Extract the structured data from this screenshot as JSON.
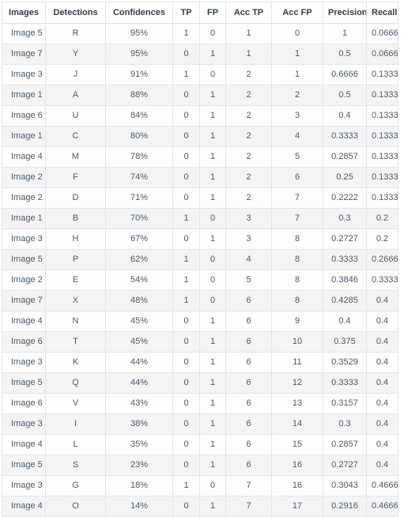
{
  "table": {
    "columns": [
      "Images",
      "Detections",
      "Confidences",
      "TP",
      "FP",
      "Acc TP",
      "Acc FP",
      "Precision",
      "Recall"
    ],
    "rows": [
      [
        "Image 5",
        "R",
        "95%",
        "1",
        "0",
        "1",
        "0",
        "1",
        "0.0666"
      ],
      [
        "Image 7",
        "Y",
        "95%",
        "0",
        "1",
        "1",
        "1",
        "0.5",
        "0.0666"
      ],
      [
        "Image 3",
        "J",
        "91%",
        "1",
        "0",
        "2",
        "1",
        "0.6666",
        "0.1333"
      ],
      [
        "Image 1",
        "A",
        "88%",
        "0",
        "1",
        "2",
        "2",
        "0.5",
        "0.1333"
      ],
      [
        "Image 6",
        "U",
        "84%",
        "0",
        "1",
        "2",
        "3",
        "0.4",
        "0.1333"
      ],
      [
        "Image 1",
        "C",
        "80%",
        "0",
        "1",
        "2",
        "4",
        "0.3333",
        "0.1333"
      ],
      [
        "Image 4",
        "M",
        "78%",
        "0",
        "1",
        "2",
        "5",
        "0.2857",
        "0.1333"
      ],
      [
        "Image 2",
        "F",
        "74%",
        "0",
        "1",
        "2",
        "6",
        "0.25",
        "0.1333"
      ],
      [
        "Image 2",
        "D",
        "71%",
        "0",
        "1",
        "2",
        "7",
        "0.2222",
        "0.1333"
      ],
      [
        "Image 1",
        "B",
        "70%",
        "1",
        "0",
        "3",
        "7",
        "0.3",
        "0.2"
      ],
      [
        "Image 3",
        "H",
        "67%",
        "0",
        "1",
        "3",
        "8",
        "0.2727",
        "0.2"
      ],
      [
        "Image 5",
        "P",
        "62%",
        "1",
        "0",
        "4",
        "8",
        "0.3333",
        "0.2666"
      ],
      [
        "Image 2",
        "E",
        "54%",
        "1",
        "0",
        "5",
        "8",
        "0.3846",
        "0.3333"
      ],
      [
        "Image 7",
        "X",
        "48%",
        "1",
        "0",
        "6",
        "8",
        "0.4285",
        "0.4"
      ],
      [
        "Image 4",
        "N",
        "45%",
        "0",
        "1",
        "6",
        "9",
        "0.4",
        "0.4"
      ],
      [
        "Image 6",
        "T",
        "45%",
        "0",
        "1",
        "6",
        "10",
        "0.375",
        "0.4"
      ],
      [
        "Image 3",
        "K",
        "44%",
        "0",
        "1",
        "6",
        "11",
        "0.3529",
        "0.4"
      ],
      [
        "Image 5",
        "Q",
        "44%",
        "0",
        "1",
        "6",
        "12",
        "0.3333",
        "0.4"
      ],
      [
        "Image 6",
        "V",
        "43%",
        "0",
        "1",
        "6",
        "13",
        "0.3157",
        "0.4"
      ],
      [
        "Image 3",
        "I",
        "38%",
        "0",
        "1",
        "6",
        "14",
        "0.3",
        "0.4"
      ],
      [
        "Image 4",
        "L",
        "35%",
        "0",
        "1",
        "6",
        "15",
        "0.2857",
        "0.4"
      ],
      [
        "Image 5",
        "S",
        "23%",
        "0",
        "1",
        "6",
        "16",
        "0.2727",
        "0.4"
      ],
      [
        "Image 3",
        "G",
        "18%",
        "1",
        "0",
        "7",
        "16",
        "0.3043",
        "0.4666"
      ],
      [
        "Image 4",
        "O",
        "14%",
        "0",
        "1",
        "7",
        "17",
        "0.2916",
        "0.4666"
      ]
    ]
  },
  "colors": {
    "header_text": "#2f3d4a",
    "body_text": "#4c5a67",
    "border": "#e2e6ea",
    "stripe": "#f2f4f6",
    "background": "#ffffff"
  }
}
